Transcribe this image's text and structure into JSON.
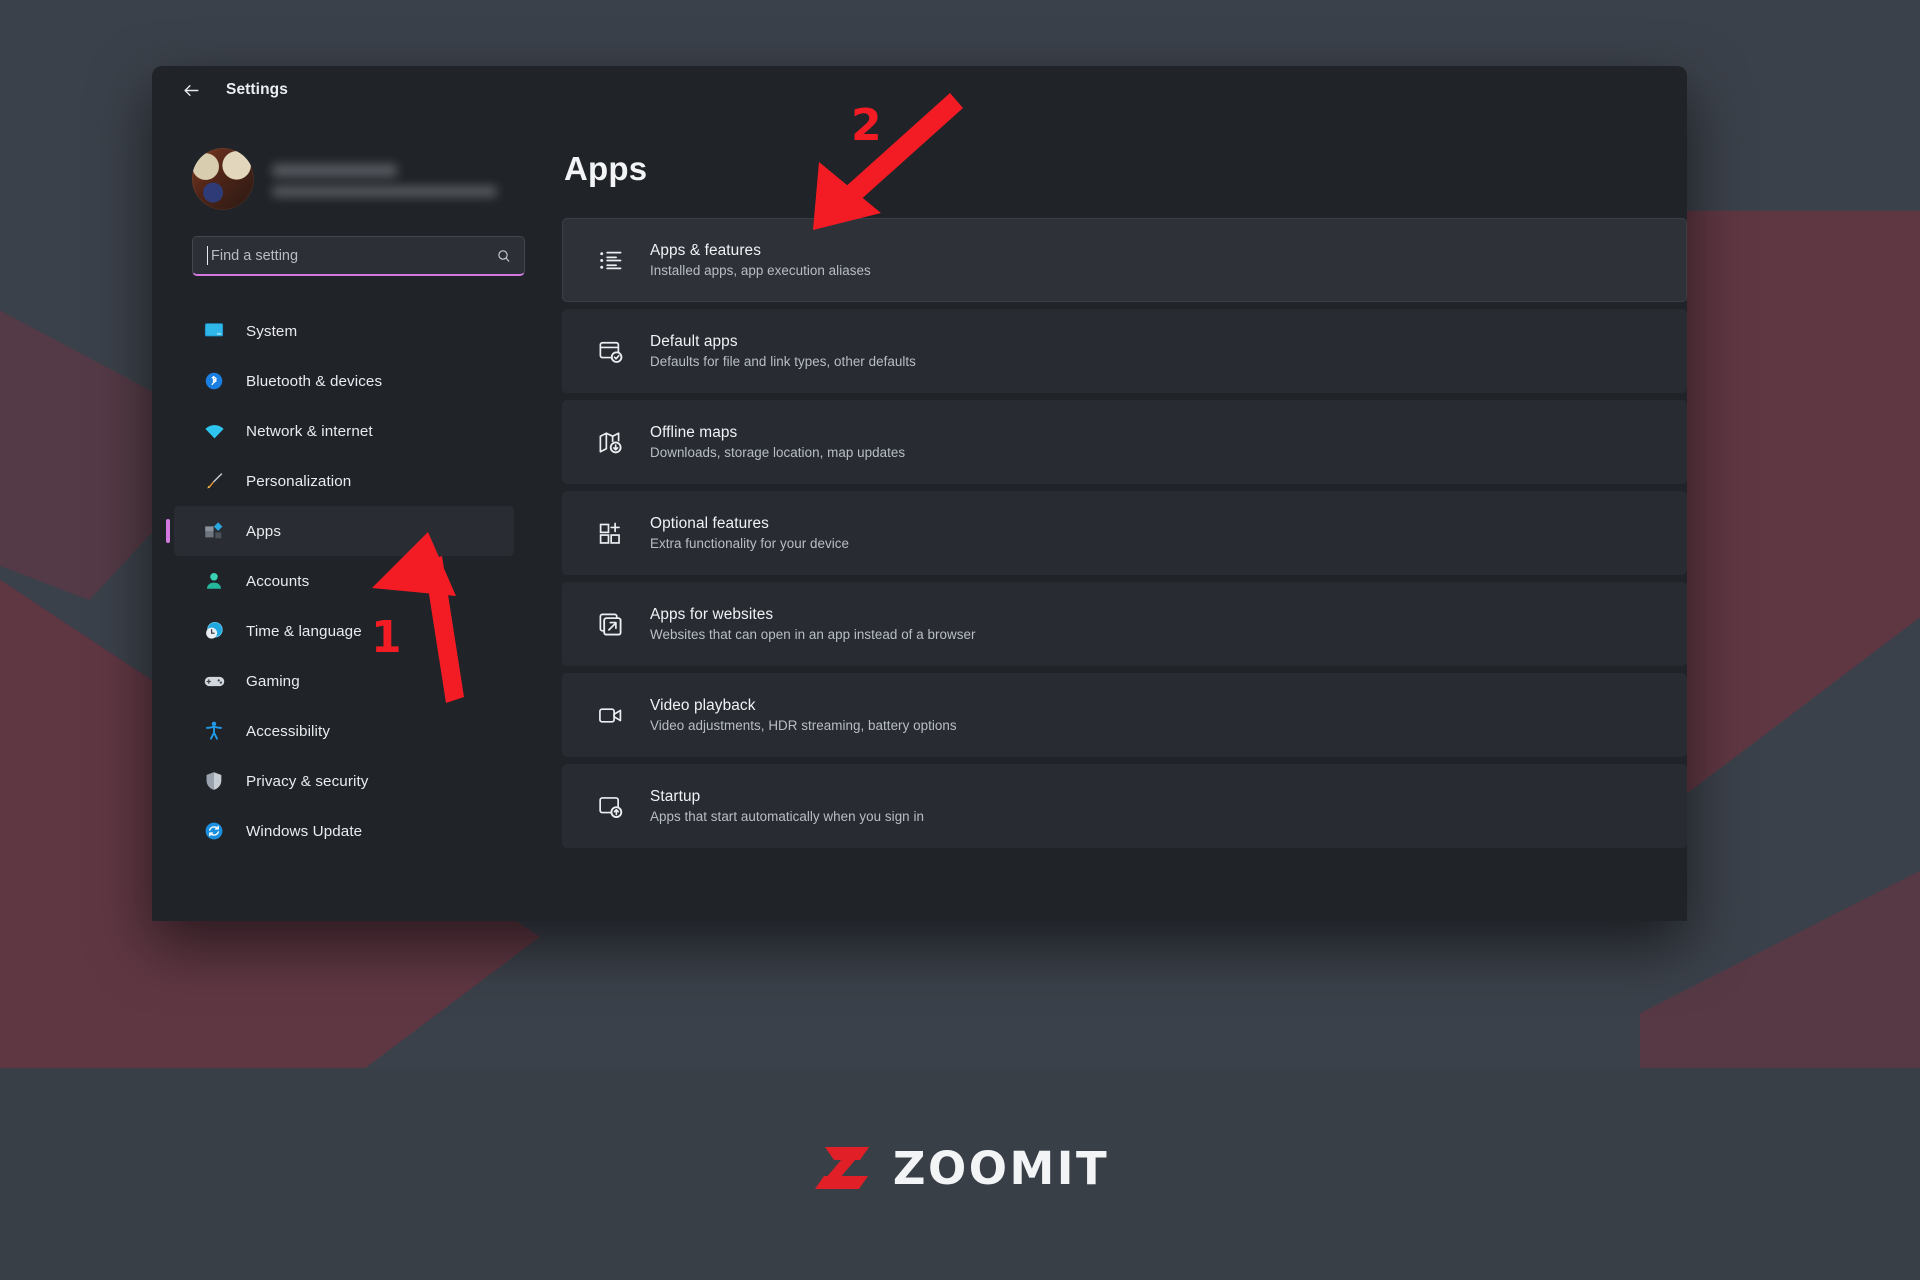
{
  "window": {
    "title": "Settings",
    "back_icon": "back-arrow-icon"
  },
  "profile": {
    "name_redacted": "",
    "email_redacted": ""
  },
  "search": {
    "placeholder": "Find a setting",
    "value": "",
    "icon": "search-icon"
  },
  "sidebar": {
    "items": [
      {
        "label": "System",
        "icon": "monitor-icon",
        "selected": false
      },
      {
        "label": "Bluetooth & devices",
        "icon": "bluetooth-icon",
        "selected": false
      },
      {
        "label": "Network & internet",
        "icon": "wifi-icon",
        "selected": false
      },
      {
        "label": "Personalization",
        "icon": "paintbrush-icon",
        "selected": false
      },
      {
        "label": "Apps",
        "icon": "apps-icon",
        "selected": true
      },
      {
        "label": "Accounts",
        "icon": "person-icon",
        "selected": false
      },
      {
        "label": "Time & language",
        "icon": "clock-globe-icon",
        "selected": false
      },
      {
        "label": "Gaming",
        "icon": "gamepad-icon",
        "selected": false
      },
      {
        "label": "Accessibility",
        "icon": "accessibility-icon",
        "selected": false
      },
      {
        "label": "Privacy & security",
        "icon": "shield-icon",
        "selected": false
      },
      {
        "label": "Windows Update",
        "icon": "update-refresh-icon",
        "selected": false
      }
    ]
  },
  "main": {
    "page_title": "Apps",
    "cards": [
      {
        "title": "Apps & features",
        "subtitle": "Installed apps, app execution aliases",
        "icon": "bulleted-list-icon",
        "highlight": true
      },
      {
        "title": "Default apps",
        "subtitle": "Defaults for file and link types, other defaults",
        "icon": "window-check-icon",
        "highlight": false
      },
      {
        "title": "Offline maps",
        "subtitle": "Downloads, storage location, map updates",
        "icon": "map-download-icon",
        "highlight": false
      },
      {
        "title": "Optional features",
        "subtitle": "Extra functionality for your device",
        "icon": "grid-plus-icon",
        "highlight": false
      },
      {
        "title": "Apps for websites",
        "subtitle": "Websites that can open in an app instead of a browser",
        "icon": "open-external-icon",
        "highlight": false
      },
      {
        "title": "Video playback",
        "subtitle": "Video adjustments, HDR streaming, battery options",
        "icon": "video-camera-icon",
        "highlight": false
      },
      {
        "title": "Startup",
        "subtitle": "Apps that start automatically when you sign in",
        "icon": "window-up-arrow-icon",
        "highlight": false
      }
    ]
  },
  "annotations": [
    {
      "label": "1",
      "points_to": "sidebar-item-apps",
      "color": "#f41c24"
    },
    {
      "label": "2",
      "points_to": "card-apps-and-features",
      "color": "#f41c24"
    }
  ],
  "watermark": {
    "text": "ZOOMIT",
    "mark_color": "#e01f26"
  },
  "colors": {
    "accent": "#d479e0",
    "window_bg": "#202328",
    "card_bg": "#282c32",
    "page_bg": "#3b414a",
    "annotation_red": "#f41c24"
  }
}
